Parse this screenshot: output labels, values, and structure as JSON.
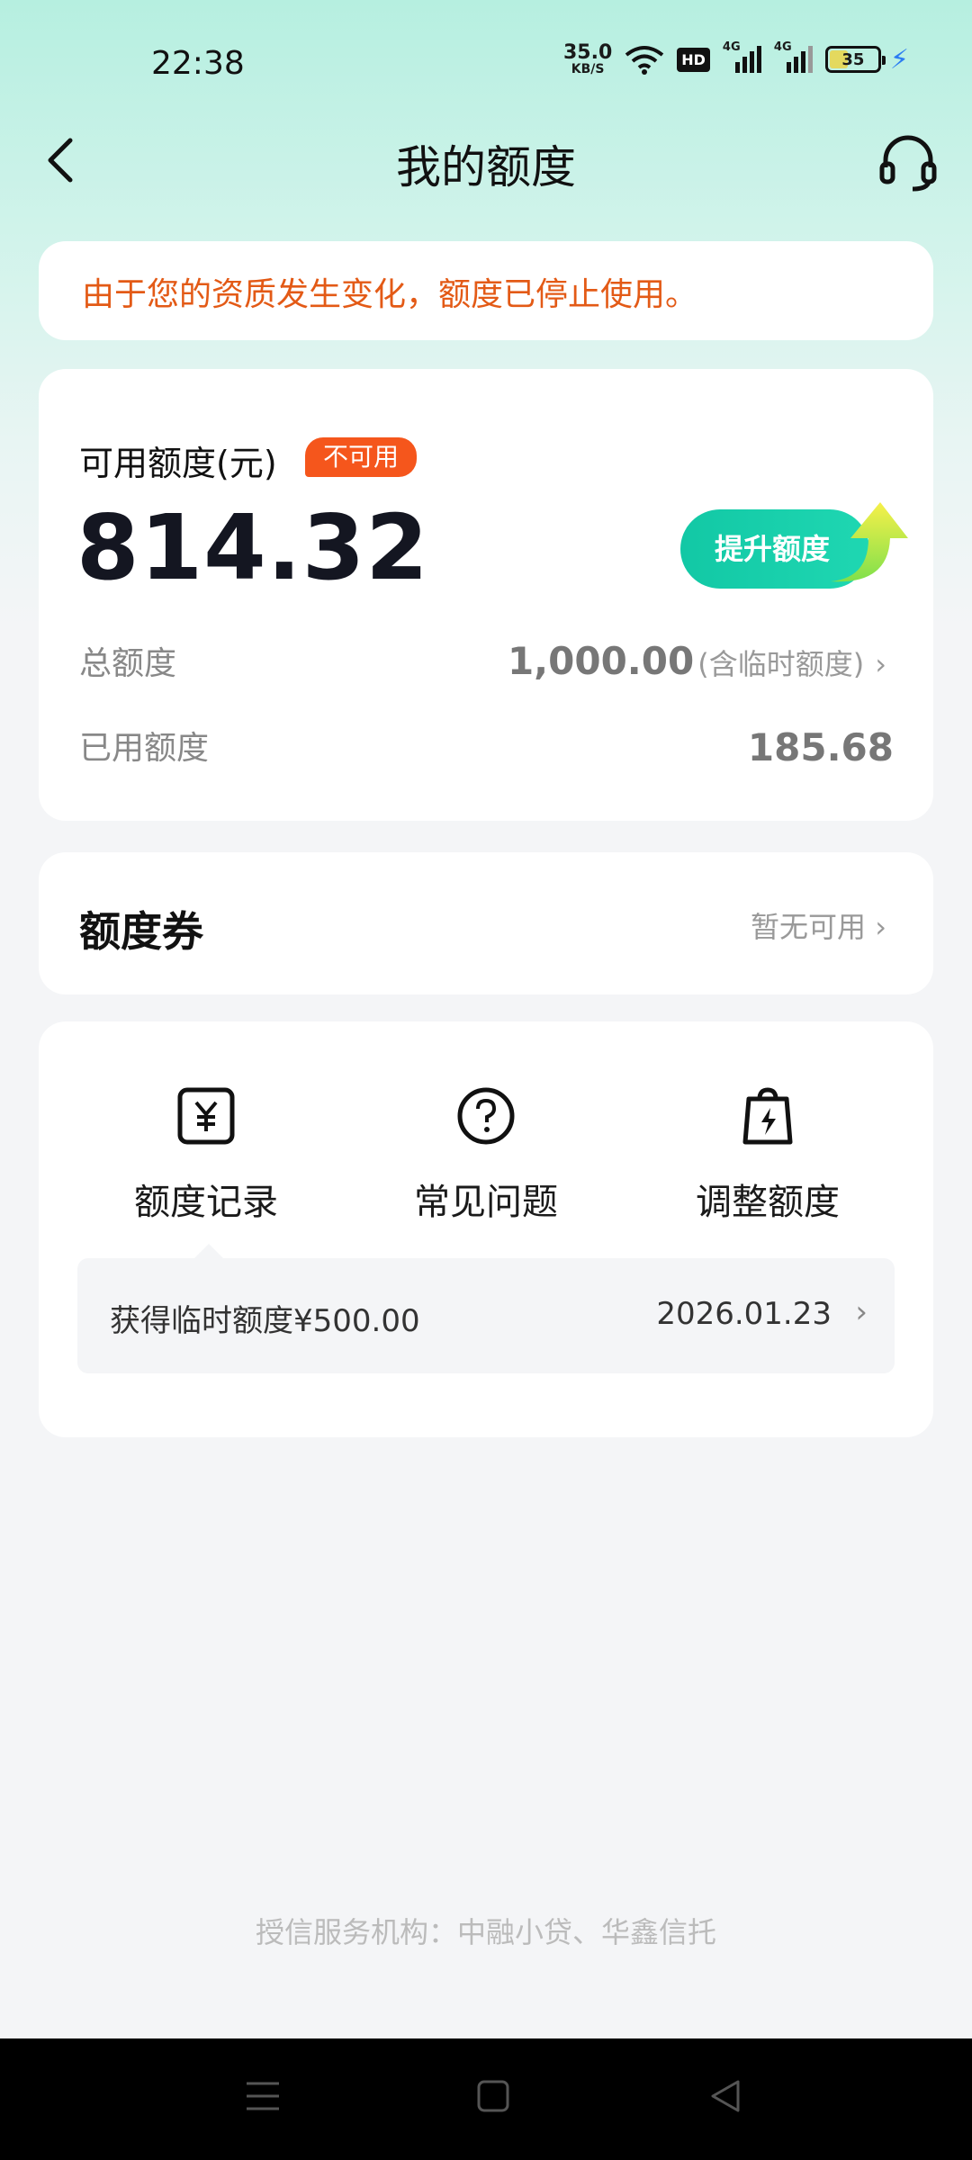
{
  "status_bar": {
    "time": "22:38",
    "net_speed": "35.0",
    "net_unit": "KB/S",
    "hd_label": "HD",
    "signal1_label": "4G",
    "signal2_label": "4G",
    "battery": "35"
  },
  "header": {
    "title": "我的额度"
  },
  "notice": {
    "text": "由于您的资质发生变化，额度已停止使用。"
  },
  "quota": {
    "available_label": "可用额度(元)",
    "badge": "不可用",
    "available_amount": "814.32",
    "raise_button": "提升额度",
    "total_label": "总额度",
    "total_value": "1,000.00",
    "total_note": "(含临时额度)",
    "used_label": "已用额度",
    "used_value": "185.68"
  },
  "voucher": {
    "title": "额度券",
    "status": "暂无可用"
  },
  "menu": {
    "items": [
      {
        "label": "额度记录",
        "icon": "yuan-icon"
      },
      {
        "label": "常见问题",
        "icon": "question-icon"
      },
      {
        "label": "调整额度",
        "icon": "bag-bolt-icon"
      }
    ],
    "record": {
      "text": "获得临时额度¥500.00",
      "date": "2026.01.23"
    }
  },
  "footer": {
    "text": "授信服务机构：中融小贷、华鑫信托"
  },
  "colors": {
    "accent": "#1fcfa9",
    "warning": "#e35a16",
    "badge": "#f5561c"
  }
}
